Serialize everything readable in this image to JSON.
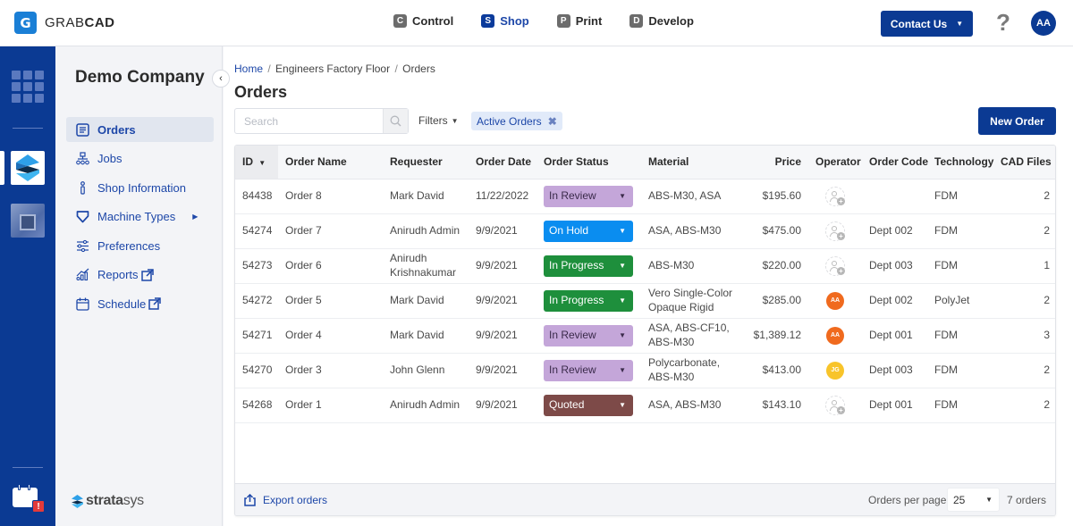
{
  "header": {
    "logo_letter": "G",
    "logo_text_light": "GRAB",
    "logo_text_bold": "CAD",
    "apps": [
      {
        "badge": "C",
        "label": "Control",
        "active": false
      },
      {
        "badge": "S",
        "label": "Shop",
        "active": true
      },
      {
        "badge": "P",
        "label": "Print",
        "active": false
      },
      {
        "badge": "D",
        "label": "Develop",
        "active": false
      }
    ],
    "contact_label": "Contact Us",
    "help_glyph": "?",
    "user_initials": "AA"
  },
  "rail": {
    "icons": [
      "app-grid-icon",
      "stratasys-app-icon",
      "machine-thumbnail",
      "calendar-alert-icon"
    ],
    "alert_glyph": "!"
  },
  "sidebar": {
    "company": "Demo Company",
    "collapse_glyph": "‹",
    "items": [
      {
        "label": "Orders",
        "icon": "orders-icon",
        "active": true
      },
      {
        "label": "Jobs",
        "icon": "jobs-icon"
      },
      {
        "label": "Shop Information",
        "icon": "info-icon"
      },
      {
        "label": "Machine Types",
        "icon": "machine-types-icon",
        "has_submenu": true
      },
      {
        "label": "Preferences",
        "icon": "preferences-icon"
      },
      {
        "label": "Reports",
        "icon": "reports-icon",
        "external": true
      },
      {
        "label": "Schedule",
        "icon": "schedule-icon",
        "external": true
      }
    ],
    "footer_brand_bold": "strata",
    "footer_brand_light": "sys"
  },
  "main": {
    "breadcrumb": [
      "Home",
      "Engineers Factory Floor",
      "Orders"
    ],
    "breadcrumb_sep": "/",
    "title": "Orders",
    "search_placeholder": "Search",
    "search_value": "",
    "filters_label": "Filters",
    "active_filter": "Active Orders",
    "new_order_label": "New Order"
  },
  "table": {
    "columns": [
      "ID",
      "Order Name",
      "Requester",
      "Order Date",
      "Order Status",
      "Material",
      "Price",
      "Operator",
      "Order Code",
      "Technology",
      "CAD Files"
    ],
    "sorted_column": "ID",
    "status_colors": {
      "In Review": {
        "bg": "#c4a6d9",
        "fg": "#3a2a4a"
      },
      "On Hold": {
        "bg": "#0a8df0",
        "fg": "#ffffff"
      },
      "In Progress": {
        "bg": "#1e8f3c",
        "fg": "#ffffff"
      },
      "Quoted": {
        "bg": "#7d4a48",
        "fg": "#ffffff"
      }
    },
    "operator_colors": {
      "AA": "#f06a1e",
      "JG": "#f8c42a"
    },
    "rows": [
      {
        "id": "84438",
        "name": "Order 8",
        "requester": "Mark David",
        "date": "11/22/2022",
        "status": "In Review",
        "material": "ABS-M30, ASA",
        "price": "$195.60",
        "operator": "",
        "code": "",
        "technology": "FDM",
        "cad_files": "2"
      },
      {
        "id": "54274",
        "name": "Order 7",
        "requester": "Anirudh Admin",
        "date": "9/9/2021",
        "status": "On Hold",
        "material": "ASA, ABS-M30",
        "price": "$475.00",
        "operator": "",
        "code": "Dept 002",
        "technology": "FDM",
        "cad_files": "2"
      },
      {
        "id": "54273",
        "name": "Order 6",
        "requester": "Anirudh Krishnakumar",
        "date": "9/9/2021",
        "status": "In Progress",
        "material": "ABS-M30",
        "price": "$220.00",
        "operator": "",
        "code": "Dept 003",
        "technology": "FDM",
        "cad_files": "1"
      },
      {
        "id": "54272",
        "name": "Order 5",
        "requester": "Mark David",
        "date": "9/9/2021",
        "status": "In Progress",
        "material": "Vero Single-Color Opaque Rigid",
        "price": "$285.00",
        "operator": "AA",
        "code": "Dept 002",
        "technology": "PolyJet",
        "cad_files": "2"
      },
      {
        "id": "54271",
        "name": "Order 4",
        "requester": "Mark David",
        "date": "9/9/2021",
        "status": "In Review",
        "material": "ASA, ABS-CF10, ABS-M30",
        "price": "$1,389.12",
        "operator": "AA",
        "code": "Dept 001",
        "technology": "FDM",
        "cad_files": "3"
      },
      {
        "id": "54270",
        "name": "Order 3",
        "requester": "John Glenn",
        "date": "9/9/2021",
        "status": "In Review",
        "material": "Polycarbonate, ABS-M30",
        "price": "$413.00",
        "operator": "JG",
        "code": "Dept 003",
        "technology": "FDM",
        "cad_files": "2"
      },
      {
        "id": "54268",
        "name": "Order 1",
        "requester": "Anirudh Admin",
        "date": "9/9/2021",
        "status": "Quoted",
        "material": "ASA, ABS-M30",
        "price": "$143.10",
        "operator": "",
        "code": "Dept 001",
        "technology": "FDM",
        "cad_files": "2"
      }
    ]
  },
  "footer": {
    "export_label": "Export orders",
    "per_page_label": "Orders per page:",
    "per_page_value": "25",
    "count_label": "7 orders"
  }
}
